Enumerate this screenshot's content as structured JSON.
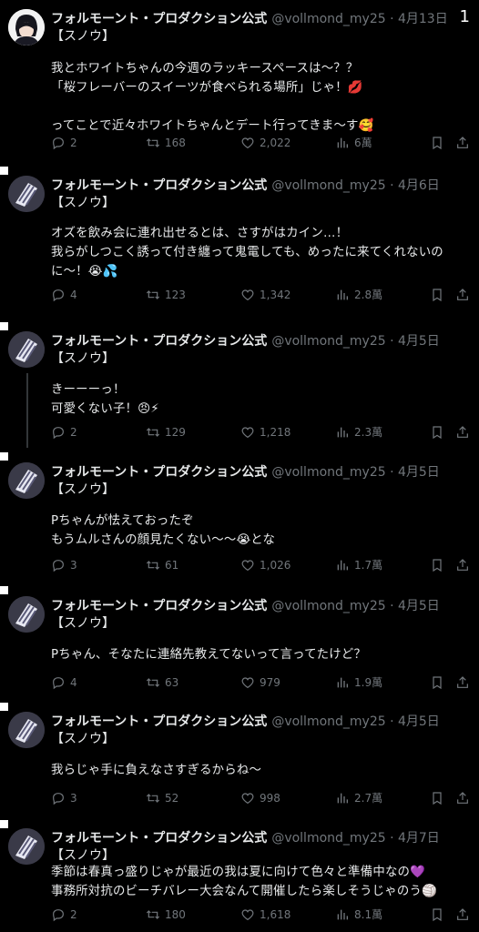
{
  "page_counter": "1",
  "tweets": [
    {
      "name": "フォルモーント・プロダクション公式",
      "handle": "@vollmond_my25 · 4月13日",
      "tag": "【スノウ】",
      "body": "我とホワイトちゃんの今週のラッキースペースは〜？？\n「桜フレーバーのスイーツが食べられる場所」じゃ！💋\n\nってことで近々ホワイトちゃんとデート行ってきま〜す🥰",
      "replies": "2",
      "retweets": "168",
      "likes": "2,022",
      "views": "6萬"
    },
    {
      "name": "フォルモーント・プロダクション公式",
      "handle": "@vollmond_my25 · 4月6日",
      "tag": "【スノウ】",
      "body": "オズを飲み会に連れ出せるとは、さすがはカイン…！\n我らがしつこく誘って付き纏って鬼電しても、めったに来てくれないのに〜！😭💦",
      "replies": "4",
      "retweets": "123",
      "likes": "1,342",
      "views": "2.8萬"
    },
    {
      "name": "フォルモーント・プロダクション公式",
      "handle": "@vollmond_my25 · 4月5日",
      "tag": "【スノウ】",
      "body": "きーーーっ！\n可愛くない子！😠⚡",
      "replies": "2",
      "retweets": "129",
      "likes": "1,218",
      "views": "2.3萬"
    },
    {
      "name": "フォルモーント・プロダクション公式",
      "handle": "@vollmond_my25 · 4月5日",
      "tag": "【スノウ】",
      "body": "Pちゃんが怯えておったぞ\nもうムルさんの顔見たくない〜〜😭とな",
      "replies": "3",
      "retweets": "61",
      "likes": "1,026",
      "views": "1.7萬"
    },
    {
      "name": "フォルモーント・プロダクション公式",
      "handle": "@vollmond_my25 · 4月5日",
      "tag": "【スノウ】",
      "body": "Pちゃん、そなたに連絡先教えてないって言ってたけど？",
      "replies": "4",
      "retweets": "63",
      "likes": "979",
      "views": "1.9萬"
    },
    {
      "name": "フォルモーント・プロダクション公式",
      "handle": "@vollmond_my25 · 4月5日",
      "tag": "【スノウ】",
      "body": "我らじゃ手に負えなさすぎるからね〜",
      "replies": "3",
      "retweets": "52",
      "likes": "998",
      "views": "2.7萬"
    },
    {
      "name": "フォルモーント・プロダクション公式",
      "handle": "@vollmond_my25 · 4月7日",
      "tag": "【スノウ】",
      "body": "季節は春真っ盛りじゃが最近の我は夏に向けて色々と準備中なの💜\n事務所対抗のビーチバレー大会なんて開催したら楽しそうじゃのう🏐",
      "replies": "2",
      "retweets": "180",
      "likes": "1,618",
      "views": "8.1萬"
    }
  ],
  "icons": {
    "reply": "reply-icon",
    "retweet": "retweet-icon",
    "like": "heart-icon",
    "views": "views-icon",
    "bookmark": "bookmark-icon",
    "share": "share-icon"
  },
  "colors": {
    "background": "#000000",
    "text": "#e7e9ea",
    "muted": "#71767b",
    "divider": "#2f3336"
  }
}
